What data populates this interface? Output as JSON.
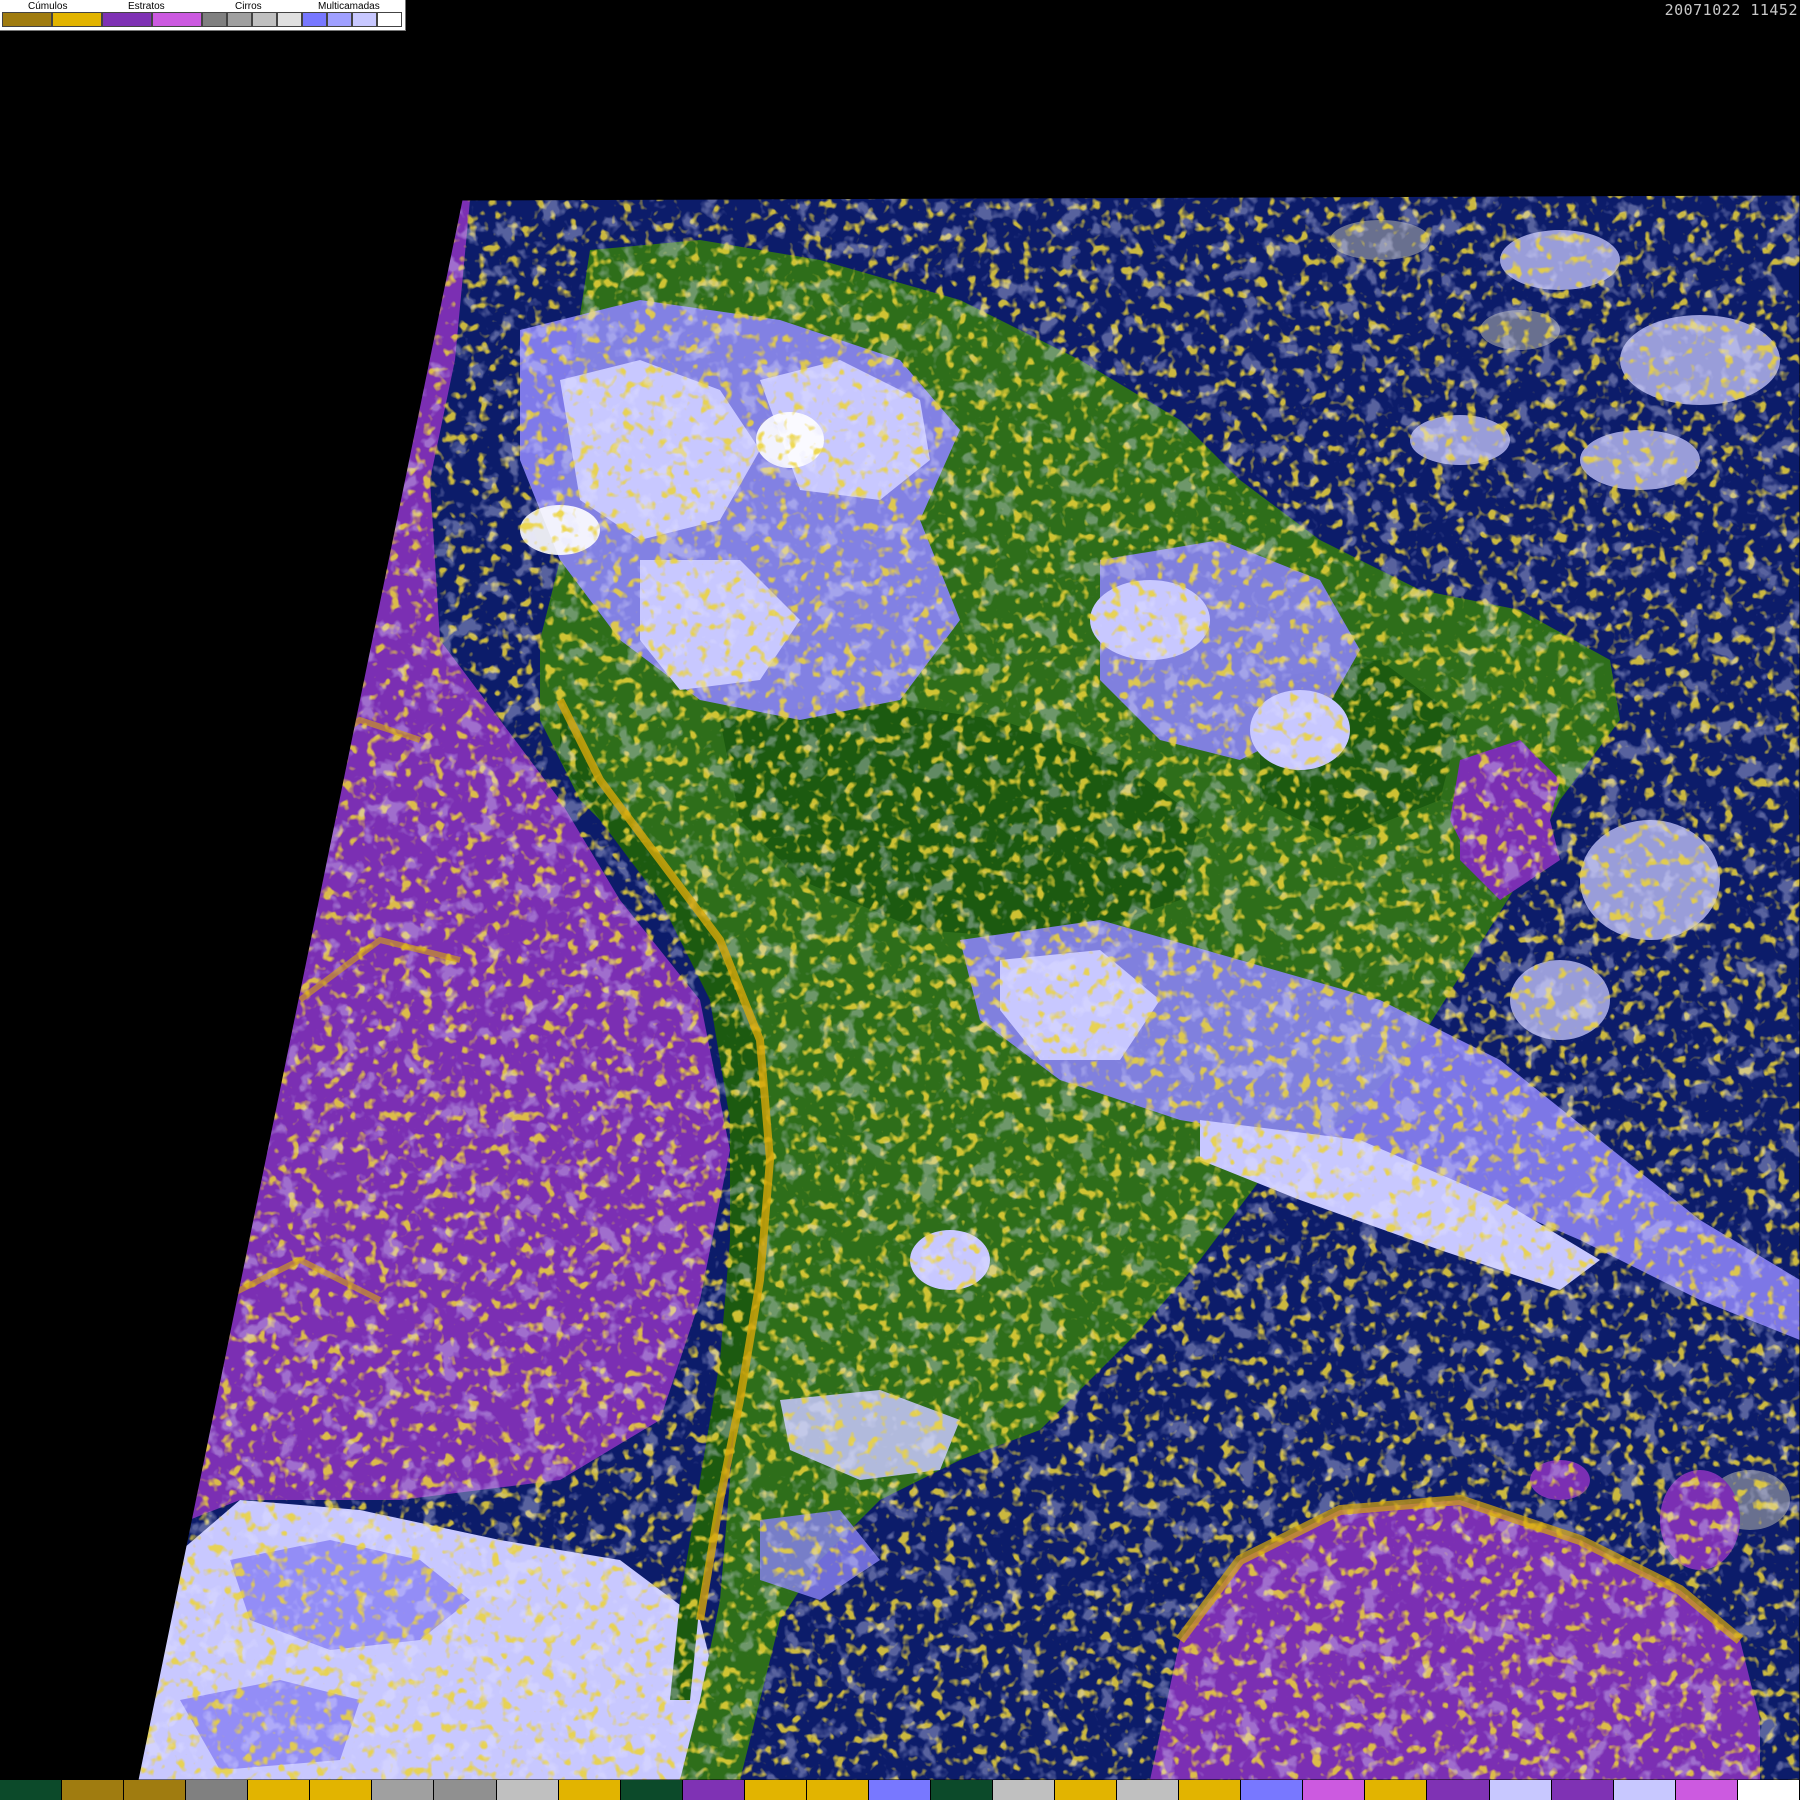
{
  "timestamp": "20071022 11452",
  "legend": {
    "groups": [
      {
        "label": "Cúmulos",
        "colors": [
          "#a07c10",
          "#e2b400"
        ]
      },
      {
        "label": "Estratos",
        "colors": [
          "#7f32b4",
          "#cc5ae0"
        ]
      },
      {
        "label": "Cirros",
        "colors": [
          "#808080",
          "#a0a0a0",
          "#c0c0c0",
          "#e0e0e0"
        ]
      },
      {
        "label": "Multicamadas",
        "colors": [
          "#7878ff",
          "#a0a0ff",
          "#c8c8ff",
          "#ffffff"
        ]
      }
    ]
  },
  "colors": {
    "ocean": "#0c1c6a",
    "stratus_sea": "#7b2fb3",
    "land_green": "#2e6e1a",
    "forest_dark": "#1c5a10",
    "cumulus_gold": "#d8a80a",
    "multilayer_light": "#c8c8ff",
    "multilayer_mid": "#8a82f4",
    "cirrus_gray": "#a8a8a8",
    "background": "#000000"
  },
  "bottom_strip": [
    "#0c4a2a",
    "#a07c10",
    "#a07c10",
    "#808080",
    "#e2b400",
    "#e2b400",
    "#a0a0a0",
    "#909090",
    "#c0c0c0",
    "#e2b400",
    "#0c4a2a",
    "#7f32b4",
    "#e2b400",
    "#e2b400",
    "#7878ff",
    "#0c4a2a",
    "#c0c0c0",
    "#e2b400",
    "#c0c0c0",
    "#e2b400",
    "#7878ff",
    "#cc5ae0",
    "#e2b400",
    "#7f32b4",
    "#c8c8ff",
    "#7f32b4",
    "#c8c8ff",
    "#cc5ae0",
    "#ffffff"
  ]
}
